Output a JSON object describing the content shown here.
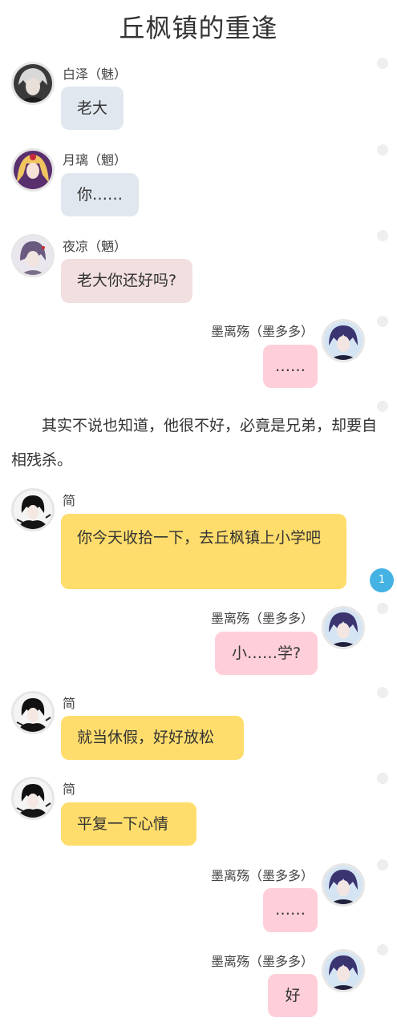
{
  "title": "丘枫镇的重逢",
  "messages": [
    {
      "sender": "白泽（魅）",
      "text": "老大"
    },
    {
      "sender": "月璃（魍）",
      "text": "你……"
    },
    {
      "sender": "夜凉（魉）",
      "text": "老大你还好吗?"
    },
    {
      "sender": "墨离殇（墨多多）",
      "text": "……"
    },
    {
      "narration": "其实不说也知道，他很不好，必竟是兄弟，却要自相残杀。"
    },
    {
      "sender": "简",
      "text": "你今天收拾一下，去丘枫镇上小学吧",
      "badge": "1"
    },
    {
      "sender": "墨离殇（墨多多）",
      "text": "小……学?"
    },
    {
      "sender": "简",
      "text": "就当休假，好好放松"
    },
    {
      "sender": "简",
      "text": "平复一下心情"
    },
    {
      "sender": "墨离殇（墨多多）",
      "text": "……"
    },
    {
      "sender": "墨离殇（墨多多）",
      "text": "好"
    }
  ],
  "colors": {
    "bubble_blue": "#e1e7ef",
    "bubble_pink": "#f2dfe0",
    "bubble_rose": "#ffcfd9",
    "bubble_yellow": "#ffdd6c",
    "badge": "#45b2e4"
  }
}
